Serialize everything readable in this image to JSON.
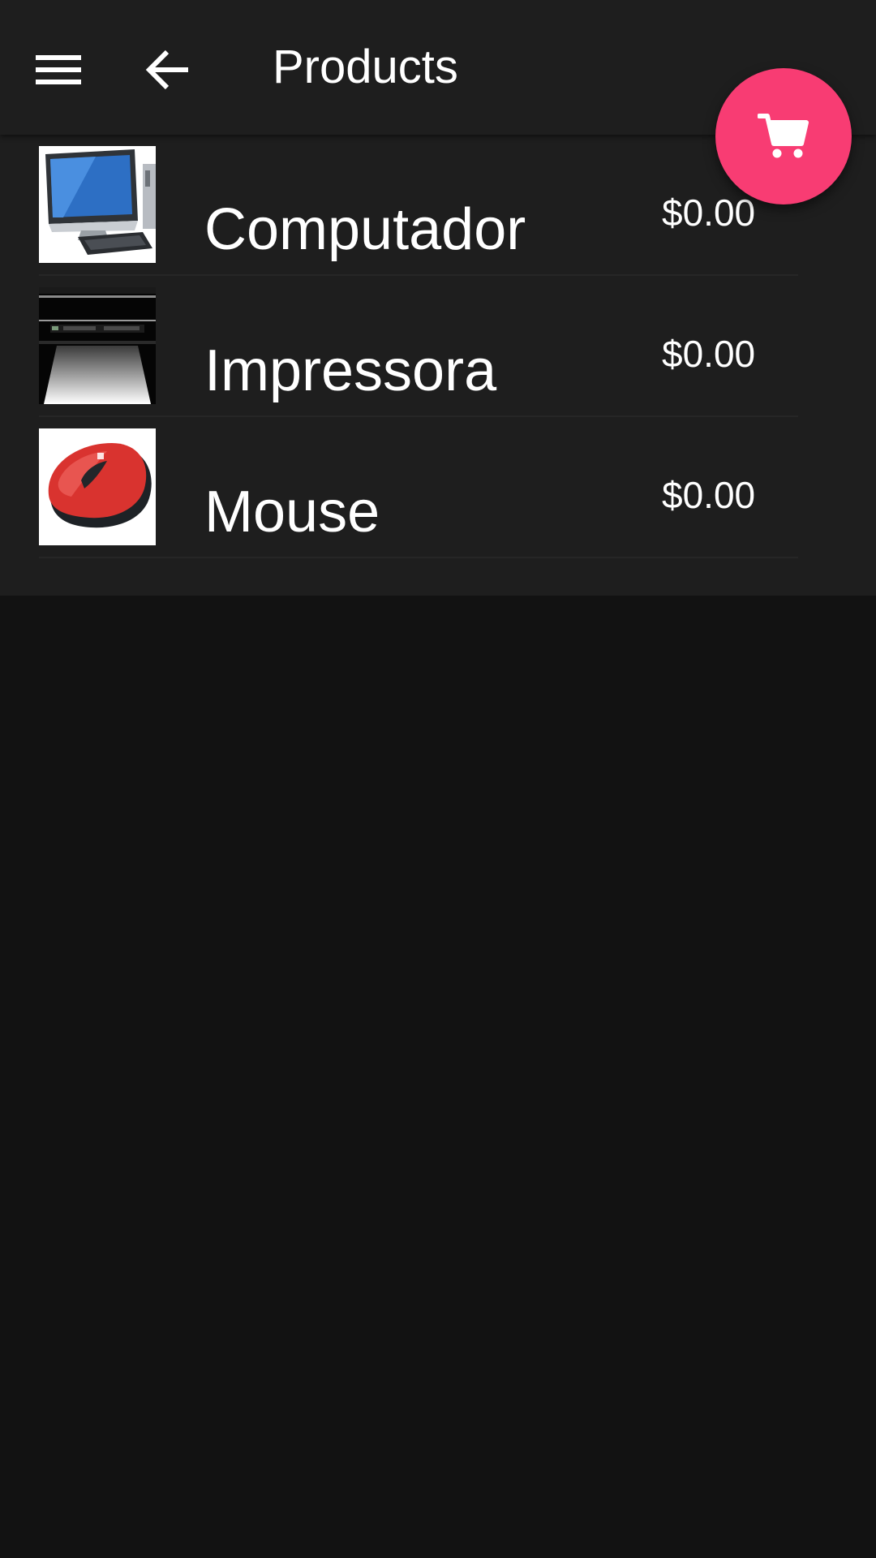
{
  "appbar": {
    "title": "Products",
    "menu_icon": "menu-icon",
    "back_icon": "arrow-back-icon"
  },
  "cart_fab": {
    "icon": "shopping-cart-icon",
    "color": "#f83c73"
  },
  "products": [
    {
      "name": "Computador",
      "price": "$0.00",
      "image": "desktop-computer-image"
    },
    {
      "name": "Impressora",
      "price": "$0.00",
      "image": "printer-image"
    },
    {
      "name": "Mouse",
      "price": "$0.00",
      "image": "red-mouse-image"
    }
  ]
}
